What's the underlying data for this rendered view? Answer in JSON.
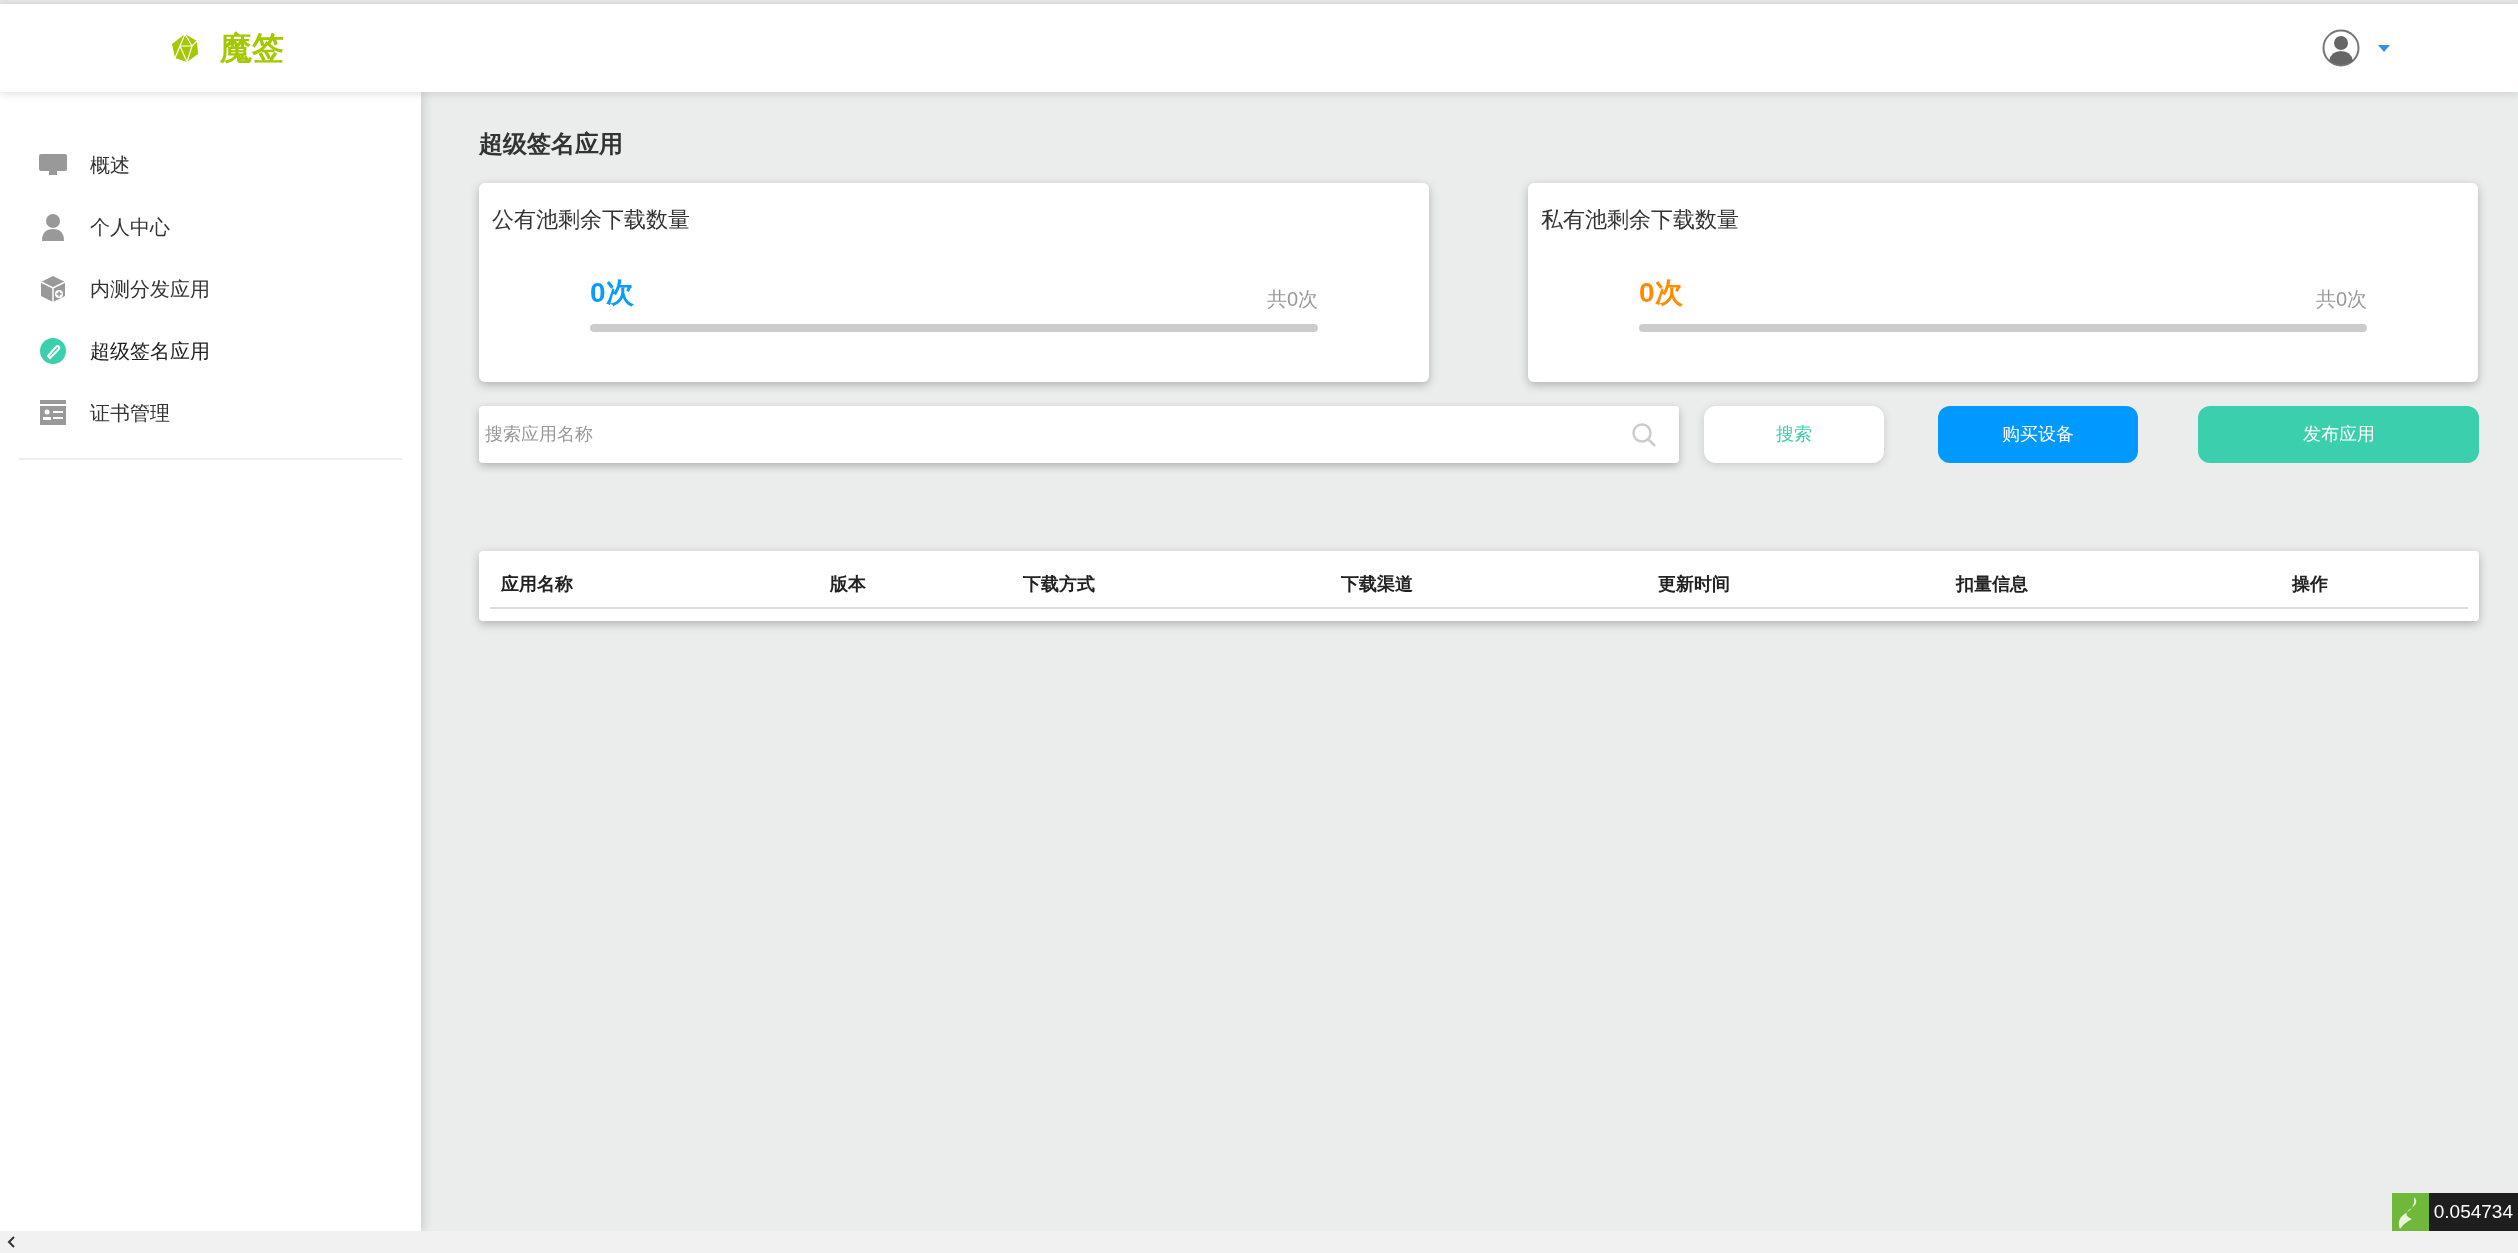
{
  "header": {
    "logo_text": "魔签"
  },
  "sidebar": {
    "items": [
      {
        "label": "概述",
        "selected": false
      },
      {
        "label": "个人中心",
        "selected": false
      },
      {
        "label": "内测分发应用",
        "selected": false
      },
      {
        "label": "超级签名应用",
        "selected": true
      },
      {
        "label": "证书管理",
        "selected": false
      }
    ]
  },
  "page_title": "超级签名应用",
  "pools": [
    {
      "title": "公有池剩余下载数量",
      "remaining": "0次",
      "total": "共0次",
      "level": 0,
      "color": "#0a9bff"
    },
    {
      "title": "私有池剩余下载数量",
      "remaining": "0次",
      "total": "共0次",
      "level": 0,
      "color": "#ff8c00"
    }
  ],
  "search": {
    "placeholder": "搜索应用名称"
  },
  "buttons": [
    {
      "label": "搜索",
      "kind": "outline"
    },
    {
      "label": "购买设备",
      "kind": "blue"
    },
    {
      "label": "发布应用",
      "kind": "green"
    }
  ],
  "table": {
    "columns": [
      "应用名称",
      "版本",
      "下载方式",
      "下载渠道",
      "更新时间",
      "扣量信息",
      "操作"
    ]
  },
  "overlay": {
    "reading": "0.054734"
  }
}
